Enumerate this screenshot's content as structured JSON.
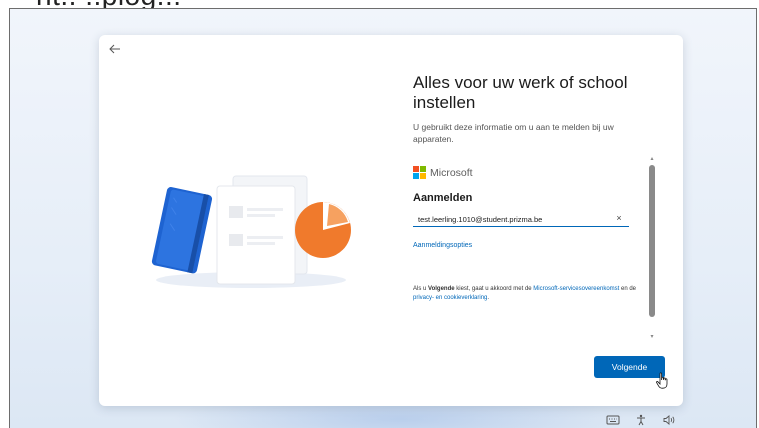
{
  "top_fragment": {
    "text": "ht.. ..plog..."
  },
  "dialog": {
    "title": "Alles voor uw werk of school instellen",
    "subtitle": "U gebruikt deze informatie om u aan te melden bij uw apparaten."
  },
  "microsoft_panel": {
    "brand": "Microsoft",
    "heading": "Aanmelden",
    "email_value": "test.leerling.1010@student.prizma.be",
    "clear_glyph": "×",
    "options_link": "Aanmeldingsopties",
    "terms": {
      "part1": "Als u ",
      "bold": "Volgende",
      "part2": " kiest, gaat u akkoord met de ",
      "link1": "Microsoft-servicesovereenkomst",
      "part3": " en de ",
      "link2": "privacy- en cookieverklaring",
      "part4": "."
    }
  },
  "buttons": {
    "next": "Volgende"
  },
  "colors": {
    "accent": "#0067b8",
    "ms_red": "#f25022",
    "ms_green": "#7fba00",
    "ms_blue": "#00a4ef",
    "ms_yellow": "#ffb900",
    "notebook_blue": "#1e63d1",
    "pie_orange": "#f07a2c"
  },
  "icons": {
    "back": "back-arrow-icon",
    "tray": [
      "keyboard-icon",
      "accessibility-icon",
      "volume-icon"
    ]
  }
}
